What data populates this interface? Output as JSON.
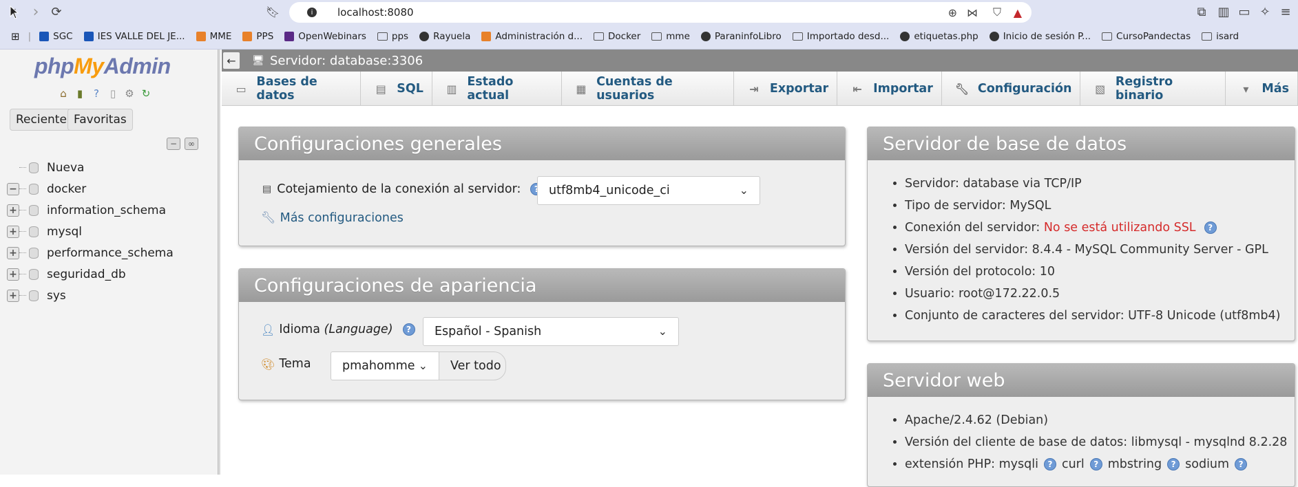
{
  "browser": {
    "url": "localhost:8080",
    "bookmarks": [
      {
        "label": "SGC",
        "icon": "school-icon",
        "color": "#1a56b8"
      },
      {
        "label": "IES VALLE DEL JE...",
        "icon": "school-icon",
        "color": "#1a56b8"
      },
      {
        "label": "MME",
        "icon": "moodle-icon",
        "color": "#e8812a"
      },
      {
        "label": "PPS",
        "icon": "moodle-icon",
        "color": "#e8812a"
      },
      {
        "label": "OpenWebinars",
        "icon": "openwebinars-icon",
        "color": "#5b2a86"
      },
      {
        "label": "pps",
        "icon": "folder-icon",
        "color": "#555555"
      },
      {
        "label": "Rayuela",
        "icon": "globe-icon",
        "color": "#333333"
      },
      {
        "label": "Administración d...",
        "icon": "moodle-icon",
        "color": "#e8812a"
      },
      {
        "label": "Docker",
        "icon": "folder-icon",
        "color": "#555555"
      },
      {
        "label": "mme",
        "icon": "folder-icon",
        "color": "#555555"
      },
      {
        "label": "ParaninfoLibro",
        "icon": "globe-icon",
        "color": "#333333"
      },
      {
        "label": "Importado desd...",
        "icon": "folder-icon",
        "color": "#555555"
      },
      {
        "label": "etiquetas.php",
        "icon": "globe-icon",
        "color": "#333333"
      },
      {
        "label": "Inicio de sesión P...",
        "icon": "globe-icon",
        "color": "#333333"
      },
      {
        "label": "CursoPandectas",
        "icon": "folder-icon",
        "color": "#555555"
      },
      {
        "label": "isard",
        "icon": "folder-icon",
        "color": "#555555"
      }
    ]
  },
  "sidebar": {
    "logo": {
      "php": "php",
      "my": "My",
      "admin": "Admin"
    },
    "tabs": {
      "recent": "Reciente",
      "favorites": "Favoritas"
    },
    "databases": [
      {
        "name": "Nueva",
        "expander": ""
      },
      {
        "name": "docker",
        "expander": "−"
      },
      {
        "name": "information_schema",
        "expander": "+"
      },
      {
        "name": "mysql",
        "expander": "+"
      },
      {
        "name": "performance_schema",
        "expander": "+"
      },
      {
        "name": "seguridad_db",
        "expander": "+"
      },
      {
        "name": "sys",
        "expander": "+"
      }
    ]
  },
  "topbar": {
    "title": "Servidor: database:3306"
  },
  "menu": [
    {
      "label": "Bases de datos",
      "icon": "database-icon"
    },
    {
      "label": "SQL",
      "icon": "sql-icon"
    },
    {
      "label": "Estado actual",
      "icon": "status-icon"
    },
    {
      "label": "Cuentas de usuarios",
      "icon": "users-icon"
    },
    {
      "label": "Exportar",
      "icon": "export-icon"
    },
    {
      "label": "Importar",
      "icon": "import-icon"
    },
    {
      "label": "Configuración",
      "icon": "wrench-icon"
    },
    {
      "label": "Registro binario",
      "icon": "binlog-icon"
    },
    {
      "label": "Más",
      "icon": "chevron-down-icon"
    }
  ],
  "general": {
    "title": "Configuraciones generales",
    "collation_label": "Cotejamiento de la conexión al servidor:",
    "collation_value": "utf8mb4_unicode_ci",
    "more_settings": "Más configuraciones"
  },
  "appearance": {
    "title": "Configuraciones de apariencia",
    "language_label": "Idioma",
    "language_label_en": "(Language)",
    "language_value": "Español - Spanish",
    "theme_label": "Tema",
    "theme_value": "pmahomme",
    "view_all": "Ver todo"
  },
  "db_server": {
    "title": "Servidor de base de datos",
    "items": [
      "Servidor: database via TCP/IP",
      "Tipo de servidor: MySQL",
      "Conexión del servidor: ",
      "Versión del servidor: 8.4.4 - MySQL Community Server - GPL",
      "Versión del protocolo: 10",
      "Usuario: root@172.22.0.5",
      "Conjunto de caracteres del servidor: UTF-8 Unicode (utf8mb4)"
    ],
    "ssl_warning": "No se está utilizando SSL"
  },
  "web_server": {
    "title": "Servidor web",
    "items": [
      "Apache/2.4.62 (Debian)",
      "Versión del cliente de base de datos: libmysql - mysqlnd 8.2.28"
    ],
    "php_ext_label": "extensión PHP: mysqli",
    "php_ext": [
      "curl",
      "mbstring",
      "sodium"
    ]
  }
}
